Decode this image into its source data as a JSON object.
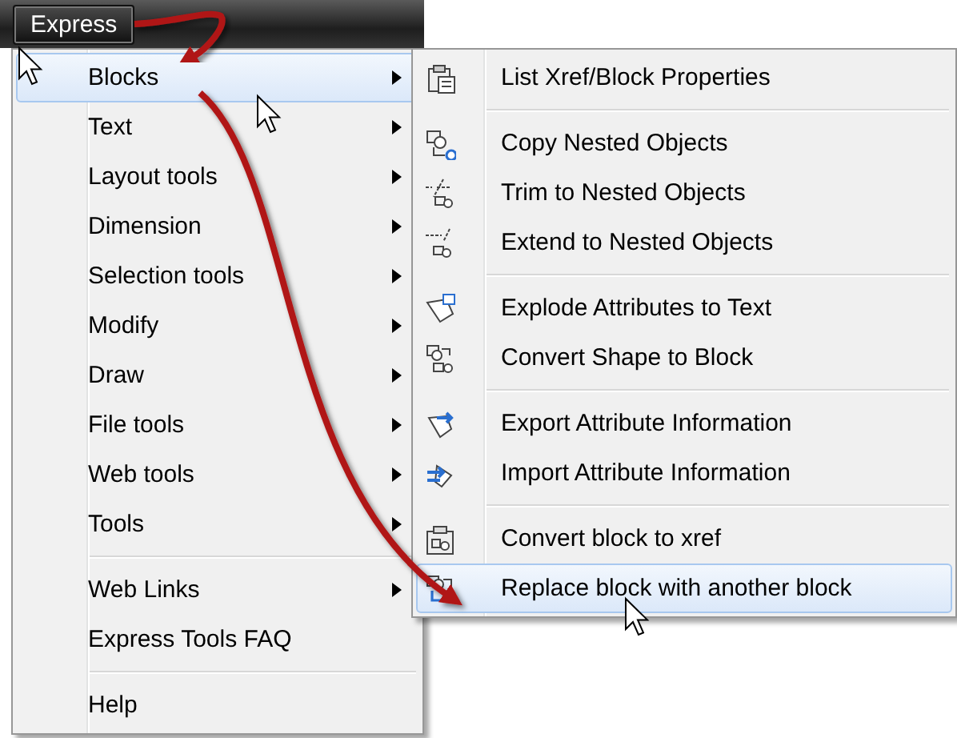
{
  "menu_bar": {
    "label": "Express",
    "selected": true
  },
  "main_menu": {
    "groups": [
      {
        "items": [
          {
            "label": "Blocks",
            "submenu": true,
            "selected": true
          },
          {
            "label": "Text",
            "submenu": true,
            "selected": false
          },
          {
            "label": "Layout tools",
            "submenu": true,
            "selected": false
          },
          {
            "label": "Dimension",
            "submenu": true,
            "selected": false
          },
          {
            "label": "Selection tools",
            "submenu": true,
            "selected": false
          },
          {
            "label": "Modify",
            "submenu": true,
            "selected": false
          },
          {
            "label": "Draw",
            "submenu": true,
            "selected": false
          },
          {
            "label": "File tools",
            "submenu": true,
            "selected": false
          },
          {
            "label": "Web tools",
            "submenu": true,
            "selected": false
          },
          {
            "label": "Tools",
            "submenu": true,
            "selected": false
          }
        ]
      },
      {
        "items": [
          {
            "label": "Web Links",
            "submenu": true,
            "selected": false
          },
          {
            "label": "Express Tools FAQ",
            "submenu": false,
            "selected": false
          }
        ]
      },
      {
        "items": [
          {
            "label": "Help",
            "submenu": false,
            "selected": false
          }
        ]
      }
    ]
  },
  "blocks_submenu": {
    "groups": [
      {
        "items": [
          {
            "label": "List Xref/Block Properties",
            "selected": false
          }
        ]
      },
      {
        "items": [
          {
            "label": "Copy Nested Objects",
            "selected": false
          },
          {
            "label": "Trim to Nested Objects",
            "selected": false
          },
          {
            "label": "Extend to Nested Objects",
            "selected": false
          }
        ]
      },
      {
        "items": [
          {
            "label": "Explode Attributes to Text",
            "selected": false
          },
          {
            "label": "Convert Shape to Block",
            "selected": false
          }
        ]
      },
      {
        "items": [
          {
            "label": "Export Attribute Information",
            "selected": false
          },
          {
            "label": "Import Attribute Information",
            "selected": false
          }
        ]
      },
      {
        "items": [
          {
            "label": "Convert block to xref",
            "selected": false
          },
          {
            "label": "Replace block with another block",
            "selected": true
          }
        ]
      }
    ]
  }
}
